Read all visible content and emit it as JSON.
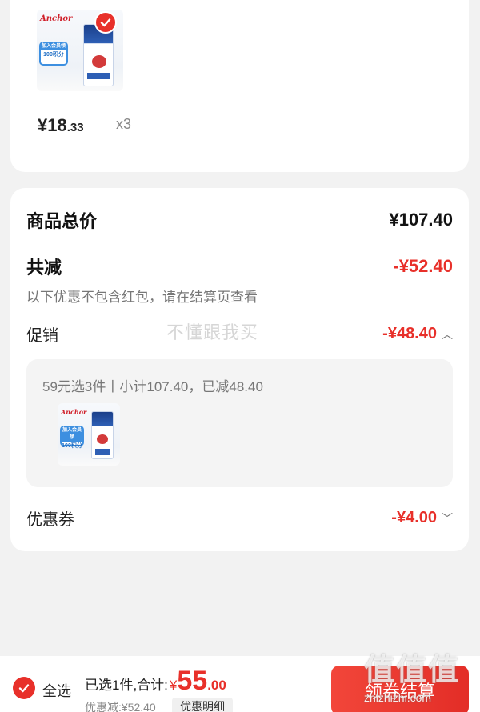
{
  "product": {
    "logo_text": "Anchor",
    "tag_line1": "加入会员领",
    "tag_line2": "100积分",
    "price_int": "¥18",
    "price_dec": ".33",
    "quantity": "x3",
    "selected": true
  },
  "summary": {
    "total_label": "商品总价",
    "total_value": "¥107.40",
    "reduce_label": "共减",
    "reduce_value": "-¥52.40",
    "note": "以下优惠不包含红包，请在结算页查看",
    "promo_label": "促销",
    "promo_value": "-¥48.40",
    "promo_detail": "59元选3件丨小计107.40，已减48.40",
    "coupon_label": "优惠券",
    "coupon_value": "-¥4.00"
  },
  "watermark_text": "不懂跟我买",
  "bottom_bar": {
    "select_all_label": "全选",
    "selected_summary": "已选1件,合计:",
    "currency": "¥",
    "total_int": "55",
    "total_dec": ".00",
    "discount_text": "优惠减:¥52.40",
    "discount_detail_button": "优惠明细",
    "checkout_button": "领券结算"
  },
  "site_watermark": {
    "mark": "值值值",
    "url": "zhizhizhi.com"
  },
  "colors": {
    "accent_red": "#e8302a",
    "background": "#f2f2f2"
  }
}
